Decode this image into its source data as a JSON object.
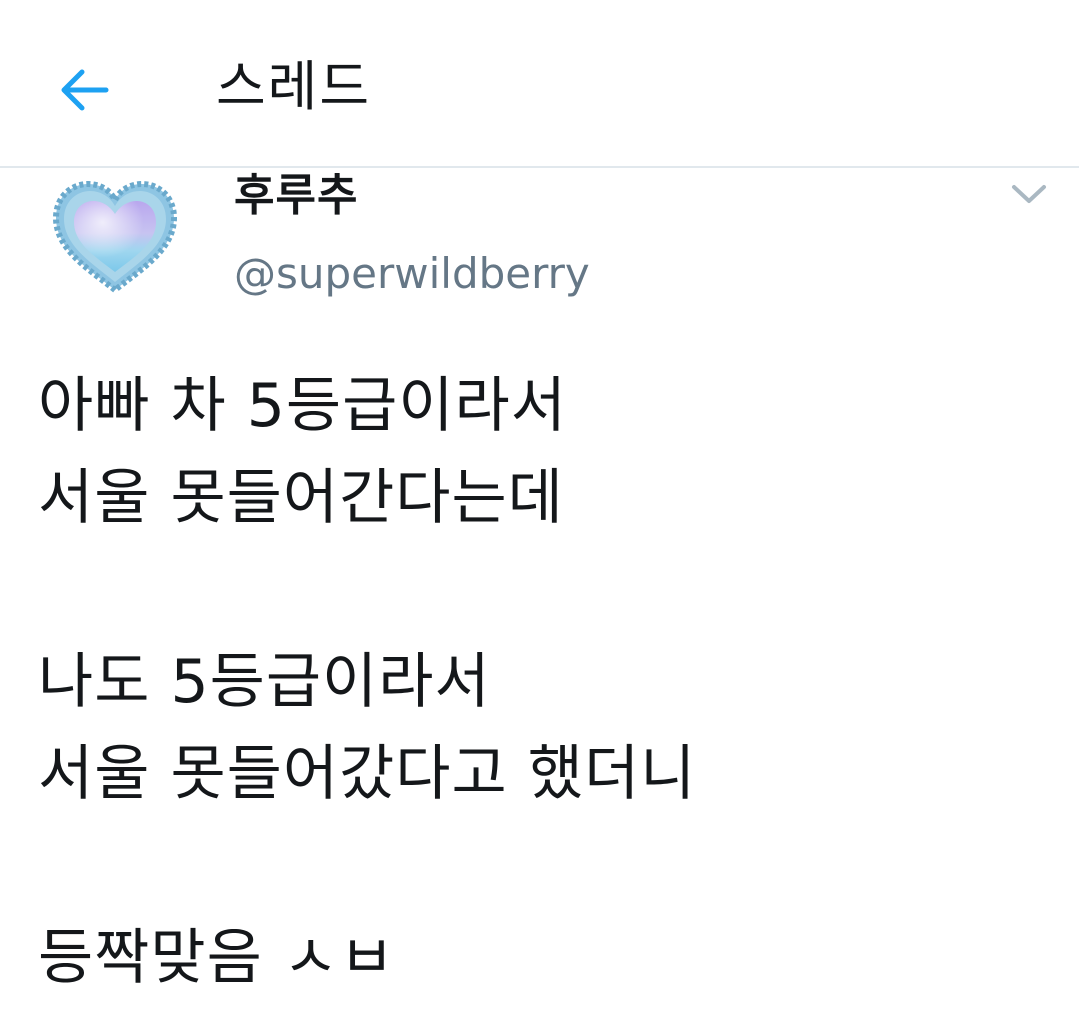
{
  "header": {
    "title": "스레드",
    "back_icon": "arrow-left-icon",
    "accent_color": "#1da1f2"
  },
  "tweet": {
    "display_name": "후루추",
    "handle": "@superwildberry",
    "avatar_icon": "heart-avatar",
    "menu_icon": "chevron-down-icon",
    "lines": [
      "아빠 차 5등급이라서",
      "서울 못들어간다는데",
      "",
      "나도 5등급이라서",
      "서울 못들어갔다고 했더니",
      "",
      "등짝맞음 ㅅㅂ"
    ]
  }
}
